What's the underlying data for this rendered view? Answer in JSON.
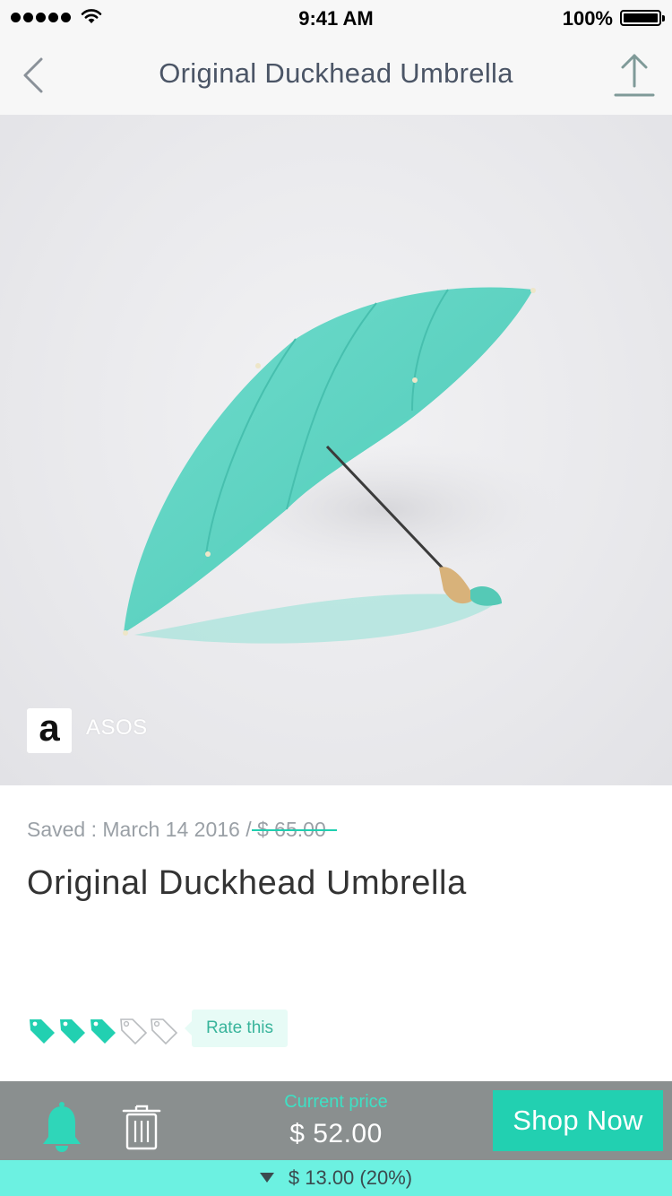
{
  "status_bar": {
    "time": "9:41 AM",
    "battery_percent": "100%",
    "battery_level": 1.0,
    "signal_bars": 5
  },
  "nav": {
    "title": "Original Duckhead Umbrella",
    "back_icon": "chevron-left-icon",
    "share_icon": "share-upload-icon"
  },
  "hero": {
    "image": "teal-umbrella-photo",
    "store": {
      "logo_letter": "a",
      "name": "ASOS"
    }
  },
  "details": {
    "saved_label": "Saved : March 14 2016 /",
    "original_price": "$ 65.00",
    "product_name": "Original Duckhead Umbrella"
  },
  "rating": {
    "value": 3,
    "max": 5,
    "icon": "price-tag-icon",
    "rate_label": "Rate this"
  },
  "bottom_bar": {
    "bell_icon": "bell-icon",
    "trash_icon": "trash-icon",
    "current_price_label": "Current price",
    "current_price": "$ 52.00",
    "shop_button": "Shop Now"
  },
  "price_drop": {
    "text": "$ 13.00 (20%)",
    "icon": "triangle-down-icon"
  },
  "colors": {
    "accent": "#22d0b1",
    "drop_bar": "#6cf1e1",
    "bottom_bar": "#8a8f8f",
    "nav_title": "#4b5566"
  }
}
